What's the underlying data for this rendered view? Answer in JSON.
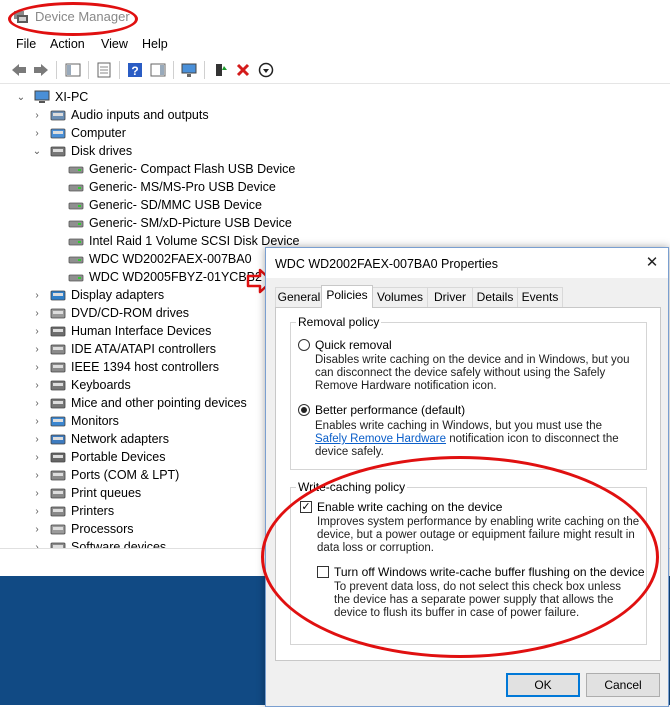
{
  "device_manager": {
    "title": "Device Manager",
    "menu": [
      "File",
      "Action",
      "View",
      "Help"
    ],
    "tree": {
      "root": "XI-PC",
      "items": [
        {
          "label": "Audio inputs and outputs",
          "expanded": false,
          "icon": "speaker-icon"
        },
        {
          "label": "Computer",
          "expanded": false,
          "icon": "computer-icon"
        },
        {
          "label": "Disk drives",
          "expanded": true,
          "icon": "disk-drive-icon",
          "children": [
            "Generic- Compact Flash USB Device",
            "Generic- MS/MS-Pro USB Device",
            "Generic- SD/MMC USB Device",
            "Generic- SM/xD-Picture USB Device",
            "Intel Raid 1 Volume SCSI Disk Device",
            "WDC WD2002FAEX-007BA0",
            "WDC WD2005FBYZ-01YCBB2"
          ]
        },
        {
          "label": "Display adapters",
          "expanded": false,
          "icon": "display-icon"
        },
        {
          "label": "DVD/CD-ROM drives",
          "expanded": false,
          "icon": "dvd-icon"
        },
        {
          "label": "Human Interface Devices",
          "expanded": false,
          "icon": "hid-icon"
        },
        {
          "label": "IDE ATA/ATAPI controllers",
          "expanded": false,
          "icon": "ide-icon"
        },
        {
          "label": "IEEE 1394 host controllers",
          "expanded": false,
          "icon": "ieee-icon"
        },
        {
          "label": "Keyboards",
          "expanded": false,
          "icon": "keyboard-icon"
        },
        {
          "label": "Mice and other pointing devices",
          "expanded": false,
          "icon": "mouse-icon"
        },
        {
          "label": "Monitors",
          "expanded": false,
          "icon": "monitor-icon"
        },
        {
          "label": "Network adapters",
          "expanded": false,
          "icon": "network-icon"
        },
        {
          "label": "Portable Devices",
          "expanded": false,
          "icon": "portable-icon"
        },
        {
          "label": "Ports (COM & LPT)",
          "expanded": false,
          "icon": "port-icon"
        },
        {
          "label": "Print queues",
          "expanded": false,
          "icon": "print-queue-icon"
        },
        {
          "label": "Printers",
          "expanded": false,
          "icon": "printer-icon"
        },
        {
          "label": "Processors",
          "expanded": false,
          "icon": "processor-icon"
        },
        {
          "label": "Software devices",
          "expanded": false,
          "icon": "software-icon"
        }
      ]
    }
  },
  "dialog": {
    "title": "WDC WD2002FAEX-007BA0 Properties",
    "tabs": [
      "General",
      "Policies",
      "Volumes",
      "Driver",
      "Details",
      "Events"
    ],
    "active_tab": "Policies",
    "removal_policy": {
      "label": "Removal policy",
      "quick_label": "Quick removal",
      "quick_desc": "Disables write caching on the device and in Windows, but you can disconnect the device safely without using the Safely Remove Hardware notification icon.",
      "better_label": "Better performance (default)",
      "better_desc_1": "Enables write caching in Windows, but you must use the",
      "better_desc_link": "Safely Remove Hardware",
      "better_desc_2": " notification icon to disconnect the device safely."
    },
    "write_caching_policy": {
      "label": "Write-caching policy",
      "enable_label": "Enable write caching on the device",
      "enable_desc": "Improves system performance by enabling write caching on the device, but a power outage or equipment failure might result in data loss or corruption.",
      "turnoff_label": "Turn off Windows write-cache buffer flushing on the device",
      "turnoff_desc": "To prevent data loss, do not select this check box unless the device has a separate power supply that allows the device to flush its buffer in case of power failure."
    },
    "ok_label": "OK",
    "cancel_label": "Cancel"
  },
  "colors": {
    "annotation": "#e01010",
    "desktop": "#114a84",
    "link": "#0a5ec9"
  }
}
